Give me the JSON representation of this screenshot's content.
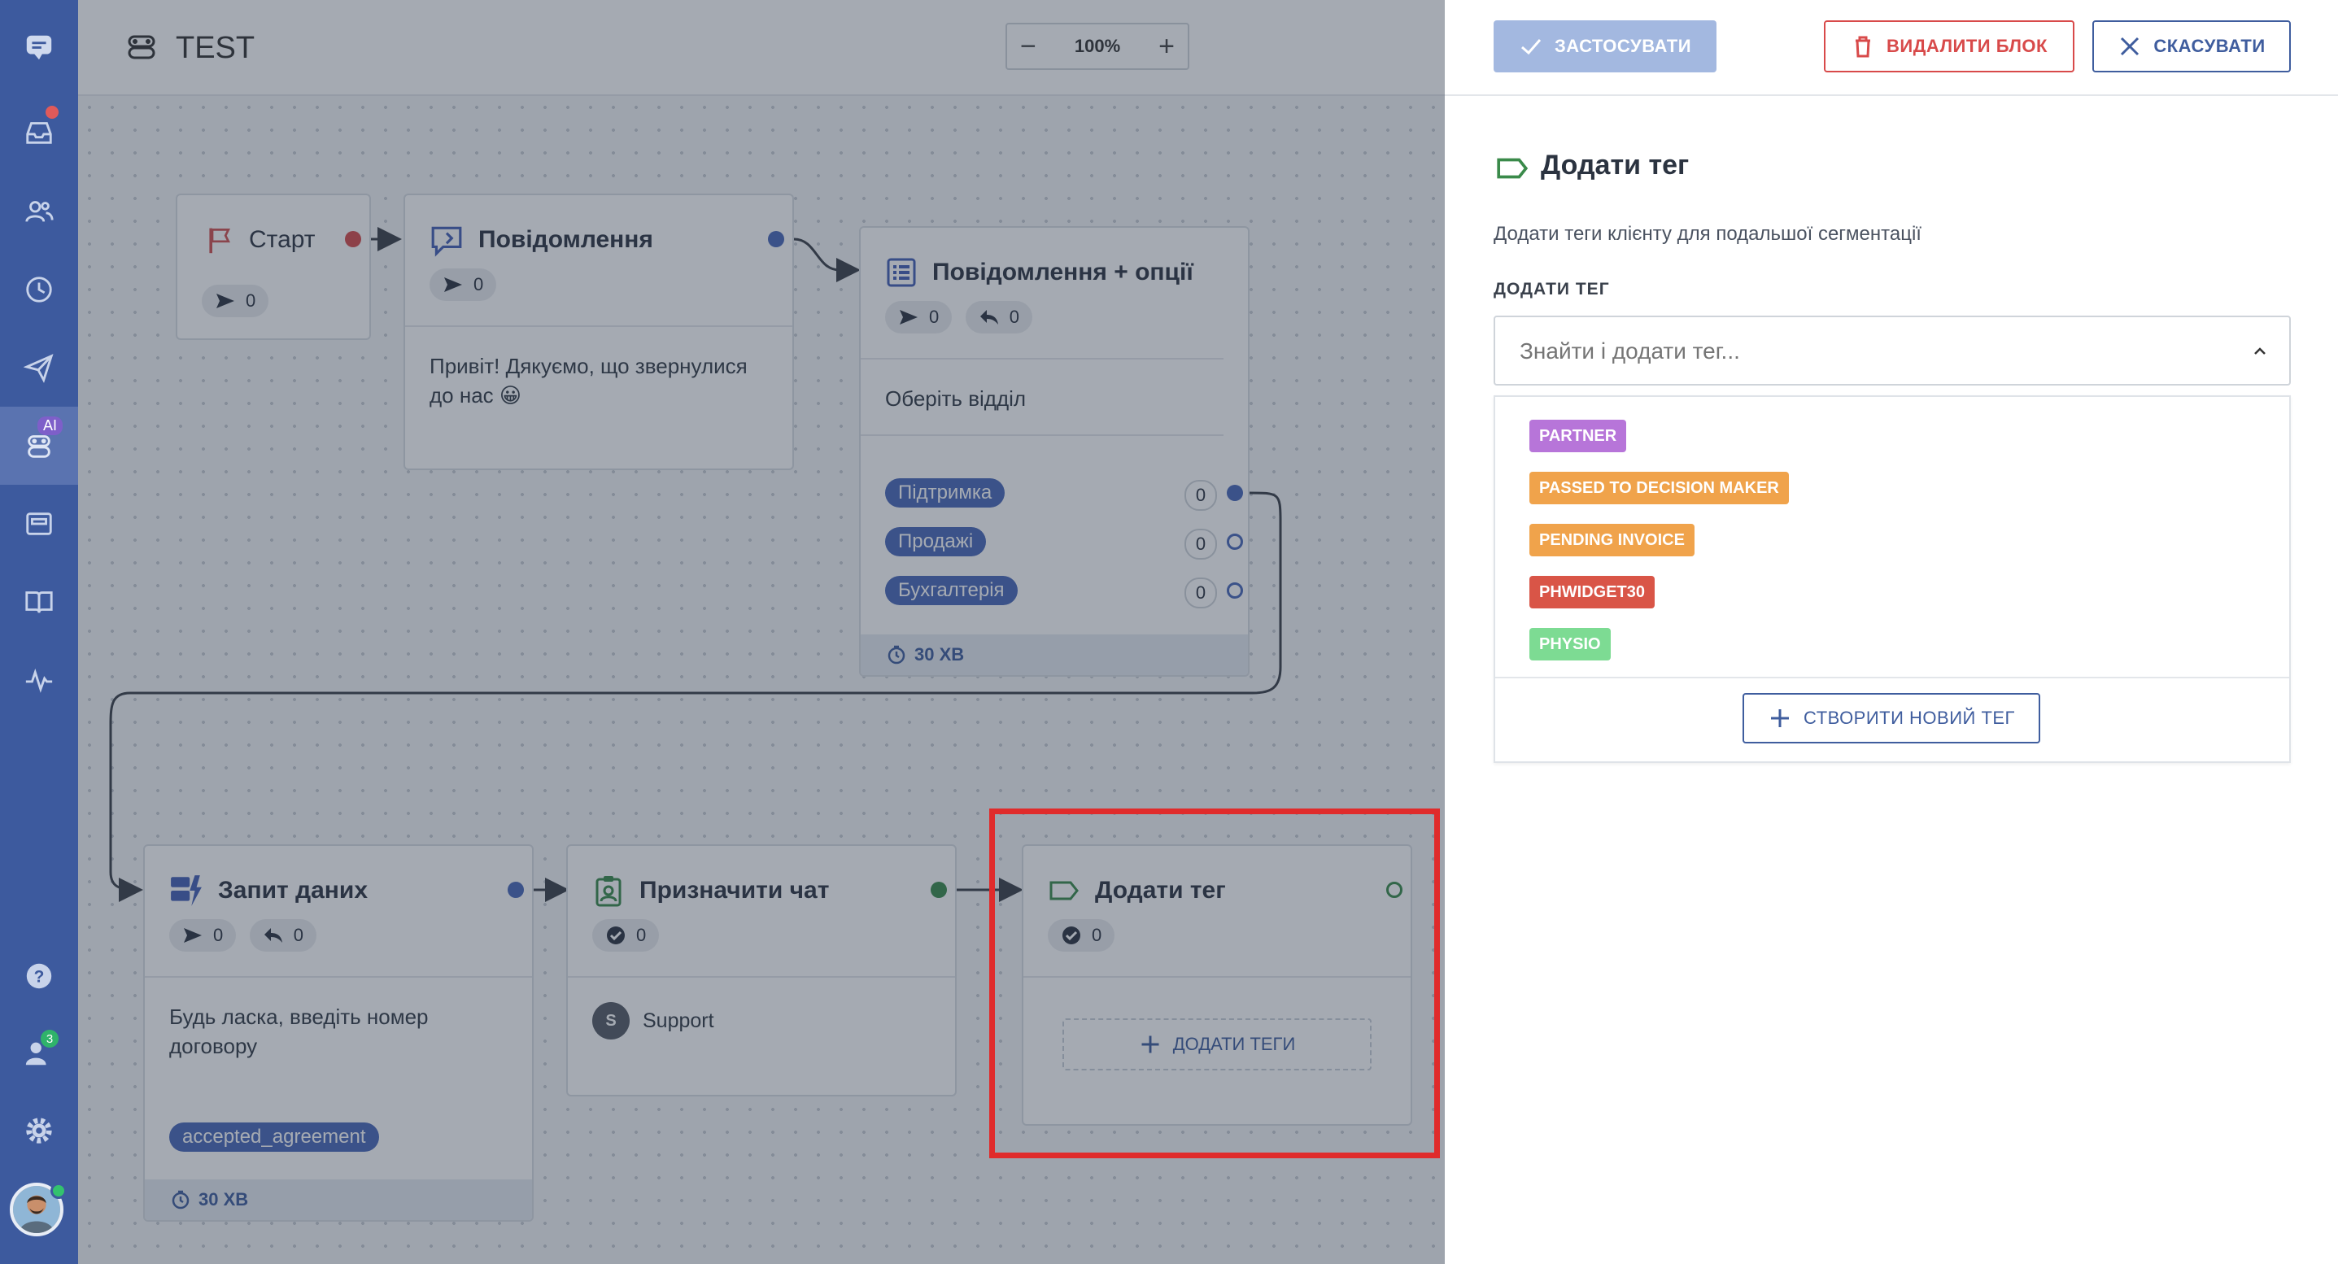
{
  "app": {
    "title": "TEST",
    "zoom": "100%"
  },
  "sidebar": {
    "ai_badge": "AI",
    "contacts_badge": "3",
    "items": [
      "chat-logo",
      "inbox",
      "contacts",
      "history",
      "broadcast",
      "chatbots",
      "widgets",
      "knowledge",
      "analytics",
      "help",
      "team",
      "settings",
      "profile"
    ]
  },
  "nodes": {
    "start": {
      "title": "Старт",
      "sent": "0"
    },
    "message": {
      "title": "Повідомлення",
      "sent": "0",
      "text": "Привіт! Дякуємо, що звернулися до нас 😀"
    },
    "options": {
      "title": "Повідомлення + опції",
      "sent": "0",
      "replied": "0",
      "text": "Оберіть відділ",
      "options": [
        {
          "label": "Підтримка",
          "count": "0"
        },
        {
          "label": "Продажі",
          "count": "0"
        },
        {
          "label": "Бухгалтерія",
          "count": "0"
        }
      ],
      "timer": "30 ХВ"
    },
    "request": {
      "title": "Запит даних",
      "sent": "0",
      "replied": "0",
      "text": "Будь ласка, введіть номер договору",
      "tag": "accepted_agreement",
      "timer": "30 ХВ"
    },
    "assign": {
      "title": "Призначити чат",
      "done": "0",
      "agent_initial": "S",
      "agent": "Support"
    },
    "addtag": {
      "title": "Додати тег",
      "done": "0",
      "add_button": "ДОДАТИ ТЕГИ"
    }
  },
  "panel": {
    "apply": "ЗАСТОСУВАТИ",
    "delete": "ВИДАЛИТИ БЛОК",
    "cancel": "СКАСУВАТИ",
    "heading": "Додати тег",
    "description": "Додати теги клієнту для подальшої сегментації",
    "field_label": "ДОДАТИ ТЕГ",
    "search_placeholder": "Знайти і додати тег...",
    "tags": [
      {
        "label": "PARTNER",
        "color": "#b775d9"
      },
      {
        "label": "PASSED TO DECISION MAKER",
        "color": "#f0a34b"
      },
      {
        "label": "PENDING INVOICE",
        "color": "#f0a34b"
      },
      {
        "label": "PHWIDGET30",
        "color": "#d95547"
      },
      {
        "label": "PHYSIO",
        "color": "#7ddb93"
      }
    ],
    "create_tag": "СТВОРИТИ НОВИЙ ТЕГ"
  },
  "colors": {
    "sidebar": "#3d5a9e",
    "accent": "#3f5d9e",
    "danger": "#d84a4a",
    "highlight": "#e02b2b",
    "green": "#3a8a4a"
  }
}
